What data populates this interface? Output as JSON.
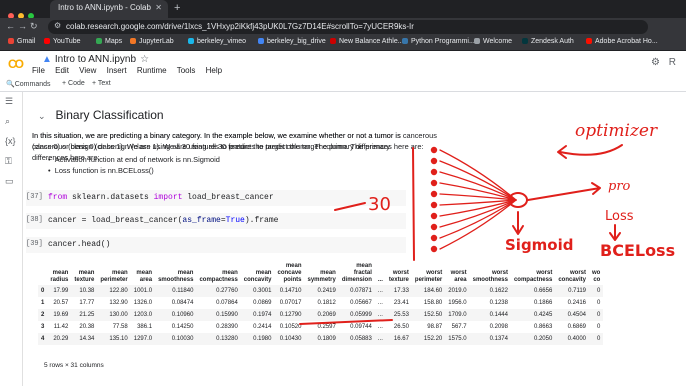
{
  "browser": {
    "tab_title": "Intro to ANN.ipynb - Colab",
    "url": "colab.research.google.com/drive/1lxcs_1VHxyp2iKkfj43pUK0L7Gz7D14E#scrollTo=7yUCER9ks-Ir",
    "bookmarks": [
      "Gmail",
      "YouTube",
      "Maps",
      "JupyterLab",
      "berkeley_vimeo",
      "berkeley_big_drive",
      "New Balance Athle...",
      "Python Programmi...",
      "Welcome",
      "Zendesk Auth",
      "Adobe Acrobat Ho..."
    ],
    "colors": {
      "chrome_dark": "#202124",
      "chrome_mid": "#35363a"
    }
  },
  "colab": {
    "notebook_title": "Intro to ANN.ipynb",
    "menu": [
      "File",
      "Edit",
      "View",
      "Insert",
      "Runtime",
      "Tools",
      "Help"
    ],
    "toolbar": {
      "commands": "Commands",
      "add_code": "+ Code",
      "add_text": "+ Text"
    },
    "header_right": "R"
  },
  "notebook": {
    "section_title": "Binary Classification",
    "paragraph": "In this situation, we are predicting a binary category. In the example below, we examine whether or not a tumor is cancerous (class 0) or benign (class 1). We are using all 30 features to predict the target column. The primary differences here are:",
    "bullets": [
      "Activation function at end of network is nn.Sigmoid",
      "Loss function is nn.BCELoss()"
    ],
    "cells": [
      {
        "prompt": "[37]",
        "kw1": "from",
        "mod": " sklearn.datasets ",
        "kw2": "import",
        "rest": " load_breast_cancer"
      },
      {
        "prompt": "[38]",
        "lhs": "cancer = load_breast_cancer(",
        "arg": "as_frame",
        "eq": "=",
        "val": "True",
        "tail": ").frame"
      },
      {
        "prompt": "[39]",
        "code": "cancer.head()"
      }
    ],
    "table": {
      "columns": [
        [
          "mean",
          "radius"
        ],
        [
          "mean",
          "texture"
        ],
        [
          "mean",
          "perimeter"
        ],
        [
          "mean",
          "area"
        ],
        [
          "mean",
          "smoothness"
        ],
        [
          "mean",
          "compactness"
        ],
        [
          "mean",
          "concavity"
        ],
        [
          "mean",
          "concave",
          "points"
        ],
        [
          "mean",
          "symmetry"
        ],
        [
          "mean",
          "fractal",
          "dimension"
        ],
        [
          "..."
        ],
        [
          "worst",
          "texture"
        ],
        [
          "worst",
          "perimeter"
        ],
        [
          "worst",
          "area"
        ],
        [
          "worst",
          "smoothness"
        ],
        [
          "worst",
          "compactness"
        ],
        [
          "worst",
          "concavity"
        ],
        [
          "wo",
          "co"
        ]
      ],
      "rows": [
        [
          "0",
          "17.99",
          "10.38",
          "122.80",
          "1001.0",
          "0.11840",
          "0.27760",
          "0.3001",
          "0.14710",
          "0.2419",
          "0.07871",
          "...",
          "17.33",
          "184.60",
          "2019.0",
          "0.1622",
          "0.6656",
          "0.7119",
          "0"
        ],
        [
          "1",
          "20.57",
          "17.77",
          "132.90",
          "1326.0",
          "0.08474",
          "0.07864",
          "0.0869",
          "0.07017",
          "0.1812",
          "0.05667",
          "...",
          "23.41",
          "158.80",
          "1956.0",
          "0.1238",
          "0.1866",
          "0.2416",
          "0"
        ],
        [
          "2",
          "19.69",
          "21.25",
          "130.00",
          "1203.0",
          "0.10960",
          "0.15990",
          "0.1974",
          "0.12790",
          "0.2069",
          "0.05999",
          "...",
          "25.53",
          "152.50",
          "1709.0",
          "0.1444",
          "0.4245",
          "0.4504",
          "0"
        ],
        [
          "3",
          "11.42",
          "20.38",
          "77.58",
          "386.1",
          "0.14250",
          "0.28390",
          "0.2414",
          "0.10520",
          "0.2597",
          "0.09744",
          "...",
          "26.50",
          "98.87",
          "567.7",
          "0.2098",
          "0.8663",
          "0.6869",
          "0"
        ],
        [
          "4",
          "20.29",
          "14.34",
          "135.10",
          "1297.0",
          "0.10030",
          "0.13280",
          "0.1980",
          "0.10430",
          "0.1809",
          "0.05883",
          "...",
          "16.67",
          "152.20",
          "1575.0",
          "0.1374",
          "0.2050",
          "0.4000",
          "0"
        ]
      ],
      "row_info": "5 rows × 31 columns"
    },
    "annotations": {
      "label_30": "30",
      "label_optimizer": "optimizer",
      "label_pro": "pro",
      "label_loss": "Loss",
      "label_sigmoid": "Sigmoid",
      "label_bceloss": "BCELoss",
      "ink_color": "#e0201b"
    }
  }
}
